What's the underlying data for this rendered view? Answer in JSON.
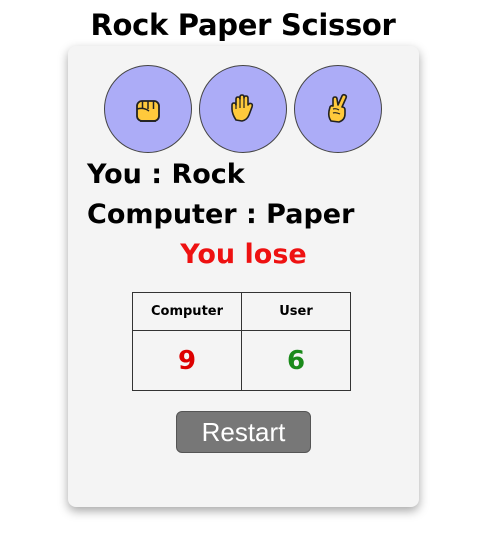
{
  "title": "Rock Paper Scissor",
  "choices": [
    {
      "name": "rock",
      "icon": "raised-fist-icon",
      "glyph": "✊"
    },
    {
      "name": "paper",
      "icon": "raised-hand-icon",
      "glyph": "✋"
    },
    {
      "name": "scissors",
      "icon": "victory-hand-icon",
      "glyph": "✌"
    }
  ],
  "player": {
    "label": "You : Rock"
  },
  "computer": {
    "label": "Computer : Paper"
  },
  "result": {
    "text": "You lose",
    "color": "#ee1111"
  },
  "scoreboard": {
    "headers": [
      "Computer",
      "User"
    ],
    "computer_score": "9",
    "user_score": "6",
    "computer_color": "#dd0000",
    "user_color": "#1a8a1a"
  },
  "restart_label": "Restart",
  "colors": {
    "choice_bg": "#acacf7",
    "hand_fill": "#ffc93c",
    "card_bg": "#f4f4f4",
    "button_bg": "#777777"
  }
}
